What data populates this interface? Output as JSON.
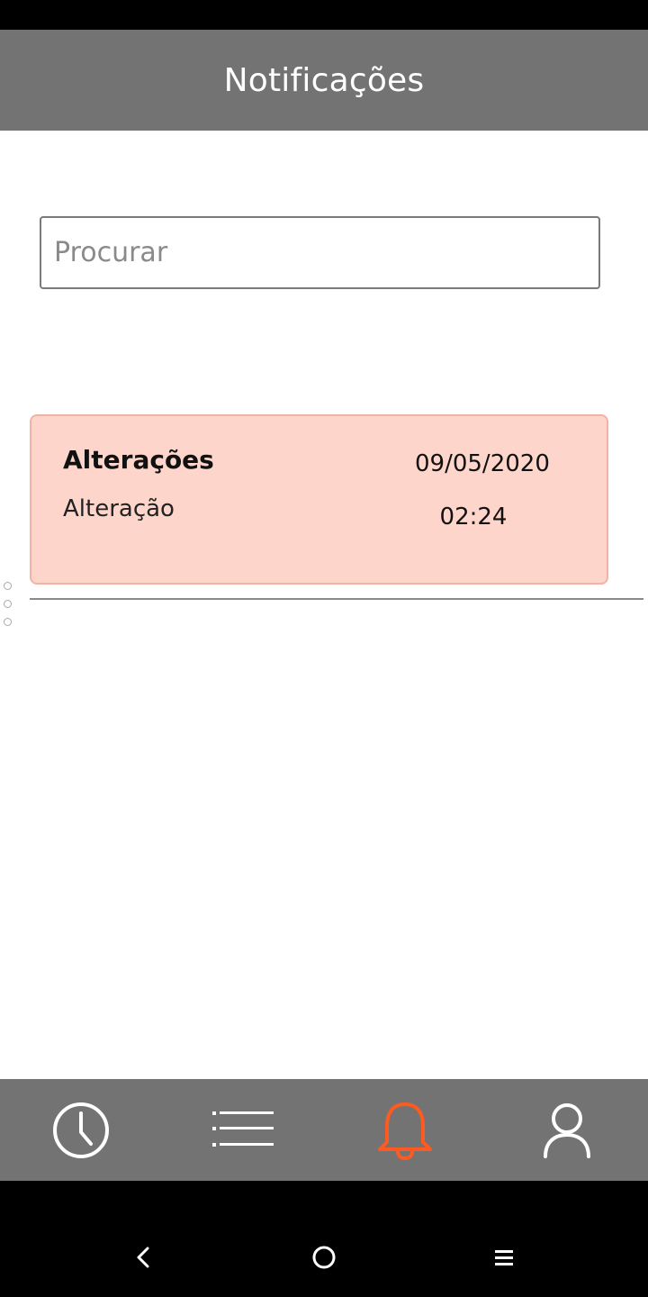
{
  "header": {
    "title": "Notificações"
  },
  "search": {
    "placeholder": "Procurar",
    "value": ""
  },
  "notifications": [
    {
      "title": "Alterações",
      "subtitle": "Alteração",
      "date": "09/05/2020",
      "time": "02:24"
    }
  ],
  "bottom_nav": {
    "items": [
      {
        "icon": "clock-icon",
        "active": false
      },
      {
        "icon": "list-icon",
        "active": false
      },
      {
        "icon": "bell-icon",
        "active": true
      },
      {
        "icon": "user-icon",
        "active": false
      }
    ],
    "active_color": "#ff5a1f",
    "inactive_color": "#ffffff"
  },
  "system_nav": {
    "items": [
      "back-icon",
      "home-icon",
      "recents-icon"
    ]
  },
  "colors": {
    "header_bg": "#737373",
    "card_bg": "#fdd5cb",
    "card_border": "#f3b3a3"
  }
}
